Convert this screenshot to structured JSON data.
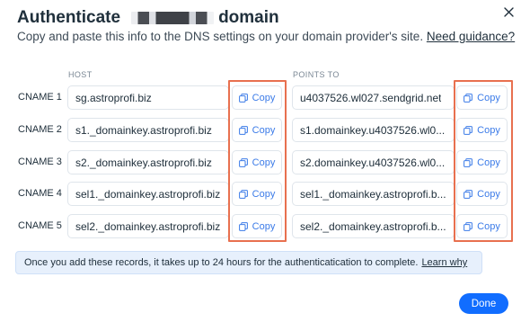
{
  "dialog": {
    "title_prefix": "Authenticate",
    "title_suffix": "domain",
    "subtitle": "Copy and paste this info to the DNS settings on your domain provider's site.",
    "guidance_link": "Need guidance?"
  },
  "columns": {
    "host": "HOST",
    "points_to": "POINTS TO"
  },
  "copy_label": "Copy",
  "records": [
    {
      "label": "CNAME 1",
      "host": "sg.astroprofi.biz",
      "points_to": "u4037526.wl027.sendgrid.net"
    },
    {
      "label": "CNAME 2",
      "host": "s1._domainkey.astroprofi.biz",
      "points_to": "s1.domainkey.u4037526.wl0..."
    },
    {
      "label": "CNAME 3",
      "host": "s2._domainkey.astroprofi.biz",
      "points_to": "s2.domainkey.u4037526.wl0..."
    },
    {
      "label": "CNAME 4",
      "host": "sel1._domainkey.astroprofi.biz",
      "points_to": "sel1._domainkey.astroprofi.b..."
    },
    {
      "label": "CNAME 5",
      "host": "sel2._domainkey.astroprofi.biz",
      "points_to": "sel2._domainkey.astroprofi.b..."
    }
  ],
  "notice": {
    "text": "Once you add these records, it takes up to 24 hours for the authenticatication to complete.",
    "link": "Learn why"
  },
  "done_label": "Done",
  "colors": {
    "accent": "#116dff",
    "highlight": "#e8704f",
    "link_blue": "#3b7be8",
    "notice_bg": "#e7f0fc"
  },
  "icons": {
    "close": "close-icon",
    "copy": "copy-icon"
  }
}
